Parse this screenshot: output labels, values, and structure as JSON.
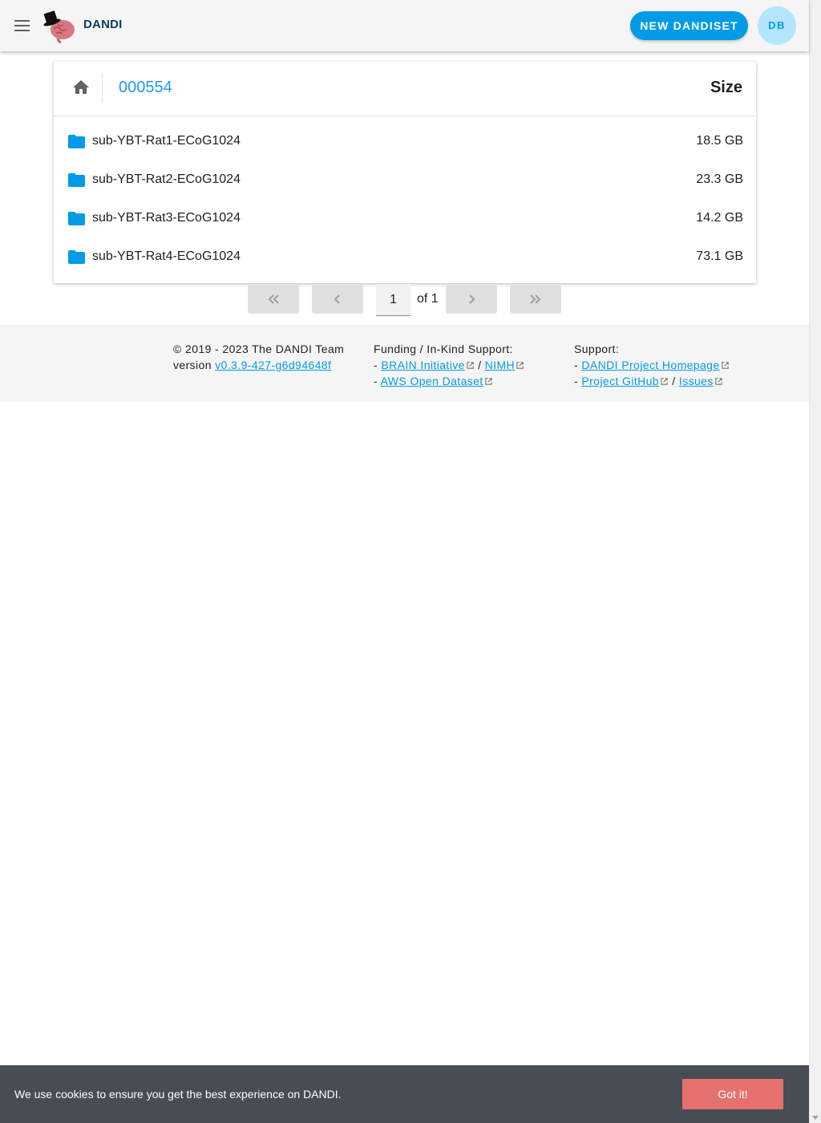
{
  "header": {
    "brand": "DANDI",
    "new_button": "NEW DANDISET",
    "avatar_initials": "DB",
    "accent_color": "#039be5"
  },
  "browser": {
    "dandiset_id": "000554",
    "size_header": "Size",
    "rows": [
      {
        "name": "sub-YBT-Rat1-ECoG1024",
        "size": "18.5 GB",
        "icon": "folder-icon"
      },
      {
        "name": "sub-YBT-Rat2-ECoG1024",
        "size": "23.3 GB",
        "icon": "folder-icon"
      },
      {
        "name": "sub-YBT-Rat3-ECoG1024",
        "size": "14.2 GB",
        "icon": "folder-icon"
      },
      {
        "name": "sub-YBT-Rat4-ECoG1024",
        "size": "73.1 GB",
        "icon": "folder-icon"
      }
    ]
  },
  "pagination": {
    "current_page": "1",
    "of_text": "of 1"
  },
  "footer": {
    "copyright": "© 2019 - 2023 The DANDI Team",
    "version_prefix": "version ",
    "version": "v0.3.9-427-g6d94648f",
    "funding_title": "Funding / In-Kind Support:",
    "funding_brain": "BRAIN Initiative",
    "funding_nimh": "NIMH",
    "funding_aws": "AWS Open Dataset",
    "support_title": "Support:",
    "support_homepage": "DANDI Project Homepage",
    "support_github": "Project GitHub",
    "support_issues": "Issues"
  },
  "cookie": {
    "message": "We use cookies to ensure you get the best experience on DANDI.",
    "button": "Got it!"
  }
}
